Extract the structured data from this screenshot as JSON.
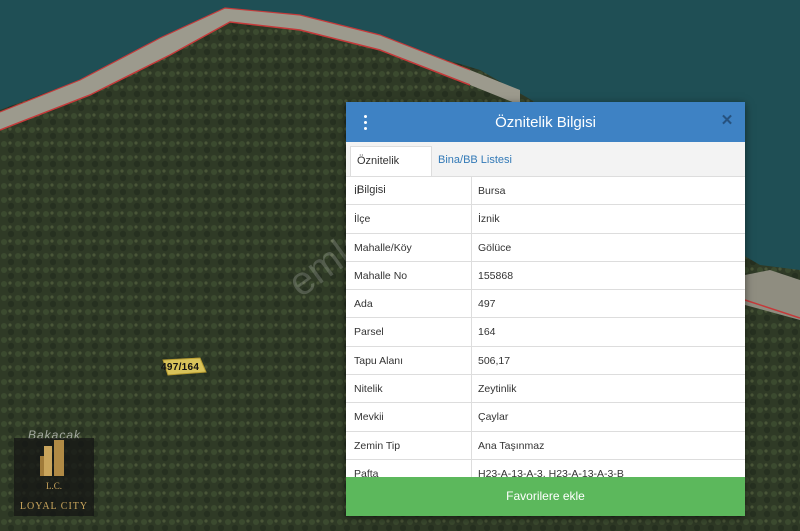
{
  "map": {
    "parcel_label": "497/164",
    "place_label": "Bakacak",
    "logo_initials": "L.C.",
    "logo_name": "LOYAL CITY"
  },
  "panel": {
    "title": "Öznitelik Bilgisi",
    "tabs": [
      {
        "label": "Öznitelik Bilgisi",
        "active": true
      },
      {
        "label": "Bina/BB Listesi",
        "active": false
      }
    ],
    "rows": [
      {
        "key": "İl",
        "value": "Bursa"
      },
      {
        "key": "İlçe",
        "value": "İznik"
      },
      {
        "key": "Mahalle/Köy",
        "value": "Gölüce"
      },
      {
        "key": "Mahalle No",
        "value": "155868"
      },
      {
        "key": "Ada",
        "value": "497"
      },
      {
        "key": "Parsel",
        "value": "164"
      },
      {
        "key": "Tapu Alanı",
        "value": "506,17"
      },
      {
        "key": "Nitelik",
        "value": "Zeytinlik"
      },
      {
        "key": "Mevkii",
        "value": "Çaylar"
      },
      {
        "key": "Zemin Tip",
        "value": "Ana Taşınmaz"
      },
      {
        "key": "Pafta",
        "value": "H23-A-13-A-3, H23-A-13-A-3-B"
      }
    ],
    "favorite_button": "Favorilere ekle"
  },
  "watermark": "emlakjet.com",
  "colors": {
    "header": "#3e82c4",
    "button": "#5cb85c",
    "water": "#1f4f55"
  }
}
